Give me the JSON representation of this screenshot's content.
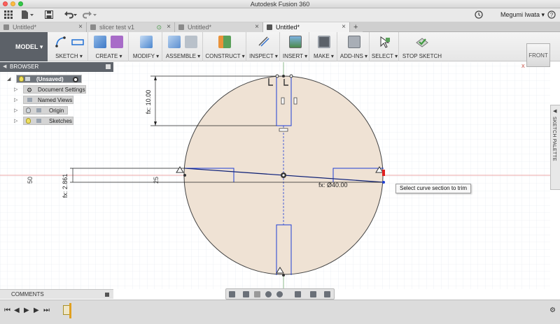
{
  "window": {
    "title": "Autodesk Fusion 360"
  },
  "quick_access": {
    "user_name": "Megumi Iwata ▾"
  },
  "tabs": [
    {
      "label": "Untitled*"
    },
    {
      "label": "slicer test v1"
    },
    {
      "label": "Untitled*"
    },
    {
      "label": "Untitled*"
    }
  ],
  "toolbar": {
    "workspace": "MODEL ▾",
    "groups": [
      {
        "label": "SKETCH ▾"
      },
      {
        "label": "CREATE ▾"
      },
      {
        "label": "MODIFY ▾"
      },
      {
        "label": "ASSEMBLE ▾"
      },
      {
        "label": "CONSTRUCT ▾"
      },
      {
        "label": "INSPECT ▾"
      },
      {
        "label": "INSERT ▾"
      },
      {
        "label": "MAKE ▾"
      },
      {
        "label": "ADD-INS ▾"
      },
      {
        "label": "SELECT ▾"
      },
      {
        "label": "STOP SKETCH"
      }
    ]
  },
  "browser": {
    "title": "BROWSER",
    "root": "(Unsaved)",
    "items": [
      {
        "label": "Document Settings"
      },
      {
        "label": "Named Views"
      },
      {
        "label": "Origin"
      },
      {
        "label": "Sketches"
      }
    ]
  },
  "viewcube": {
    "face": "FRONT",
    "x_axis": "X",
    "z_axis": "Z"
  },
  "sketch_palette": {
    "label": "SKETCH PALETTE"
  },
  "comments": {
    "label": "COMMENTS"
  },
  "sketch": {
    "dim_top": "fx: 10.00",
    "dim_left": "fx: 2.861",
    "dim_diameter": "fx: Ø40.00",
    "dim_25": "25",
    "dim_50": "50"
  },
  "tooltip": {
    "text": "Select curve section to trim"
  },
  "colors": {
    "sketch_fill": "#efe2d4",
    "profile_line": "#1f3fd4",
    "axis_red": "#e06060",
    "grid": "#dfe6ef",
    "dark_toolbar": "#5c6168"
  },
  "timeline": {
    "controls": [
      "first",
      "previous",
      "play",
      "next",
      "last"
    ]
  }
}
